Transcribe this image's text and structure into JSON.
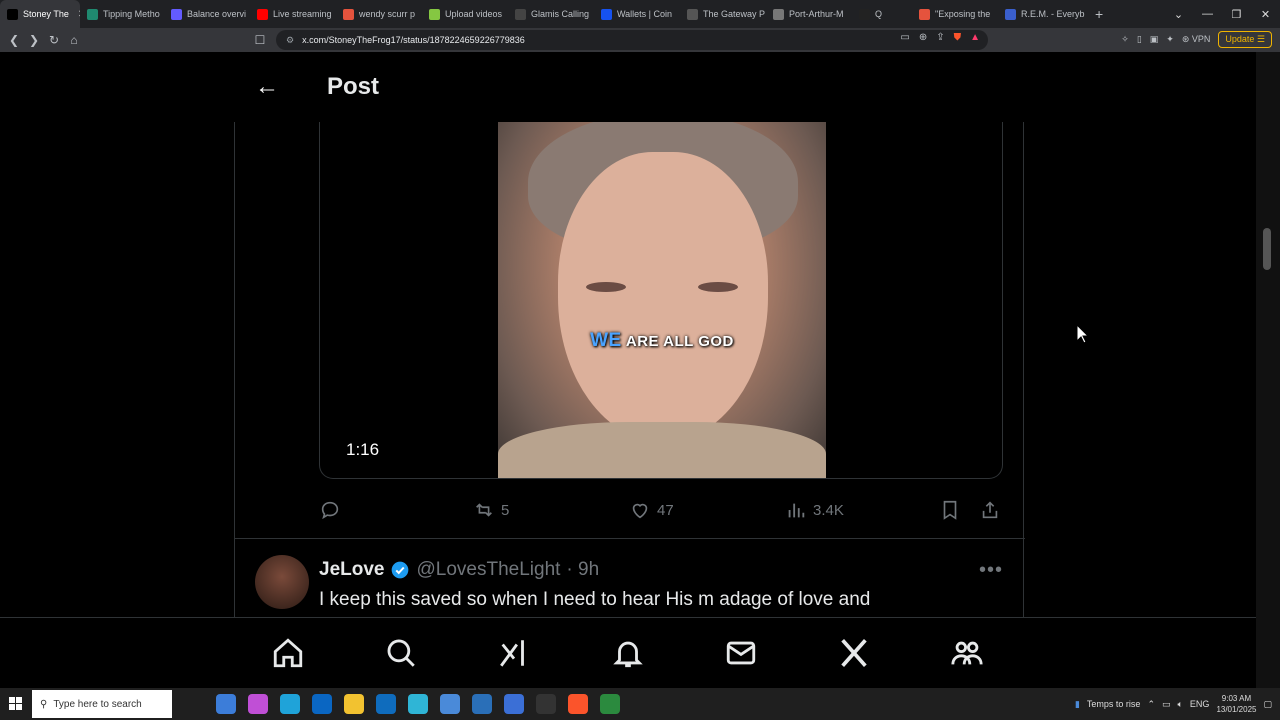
{
  "browser": {
    "tabs": [
      {
        "label": "Stoney The",
        "active": true,
        "icon": "x-logo-icon",
        "color": "#000000"
      },
      {
        "label": "Tipping Metho",
        "icon": "tipping-icon",
        "color": "#1f8a70"
      },
      {
        "label": "Balance overvi",
        "icon": "stripe-icon",
        "color": "#635bff"
      },
      {
        "label": "Live streaming",
        "icon": "youtube-icon",
        "color": "#ff0000"
      },
      {
        "label": "wendy scurr p",
        "icon": "brave-search-icon",
        "color": "#e5533d"
      },
      {
        "label": "Upload videos",
        "icon": "rumble-icon",
        "color": "#85c742"
      },
      {
        "label": "Glamis Calling",
        "icon": "glamis-icon",
        "color": "#444444"
      },
      {
        "label": "Wallets | Coin",
        "icon": "coinbase-icon",
        "color": "#1652f0"
      },
      {
        "label": "The Gateway P",
        "icon": "gateway-icon",
        "color": "#555555"
      },
      {
        "label": "Port-Arthur-M",
        "icon": "globe-icon",
        "color": "#777777"
      },
      {
        "label": "Q",
        "icon": "q-icon",
        "color": "#222222"
      },
      {
        "label": "\"Exposing the",
        "icon": "brave-search-icon",
        "color": "#e5533d"
      },
      {
        "label": "R.E.M. - Everyb",
        "icon": "rem-icon",
        "color": "#3a5fcd"
      }
    ],
    "url": "x.com/StoneyTheFrog17/status/1878224659226779836",
    "vpn_label": "VPN",
    "update_label": "Update"
  },
  "post": {
    "title": "Post",
    "video": {
      "caption_highlight": "WE",
      "caption_rest": "ARE ALL GOD",
      "duration": "1:16"
    },
    "actions": {
      "retweets": "5",
      "likes": "47",
      "views": "3.4K"
    }
  },
  "reply": {
    "name": "JeLove",
    "handle": "@LovesTheLight",
    "time": "· 9h",
    "text": "I keep this saved so when I need to hear His m adage of love and"
  },
  "bottom_nav": [
    "home-icon",
    "search-icon",
    "grok-icon",
    "notifications-icon",
    "messages-icon",
    "x-logo-icon",
    "communities-icon"
  ],
  "taskbar": {
    "search_placeholder": "Type here to search",
    "weather": "Temps to rise",
    "language": "ENG",
    "time": "9:03 AM",
    "date": "13/01/2025"
  }
}
